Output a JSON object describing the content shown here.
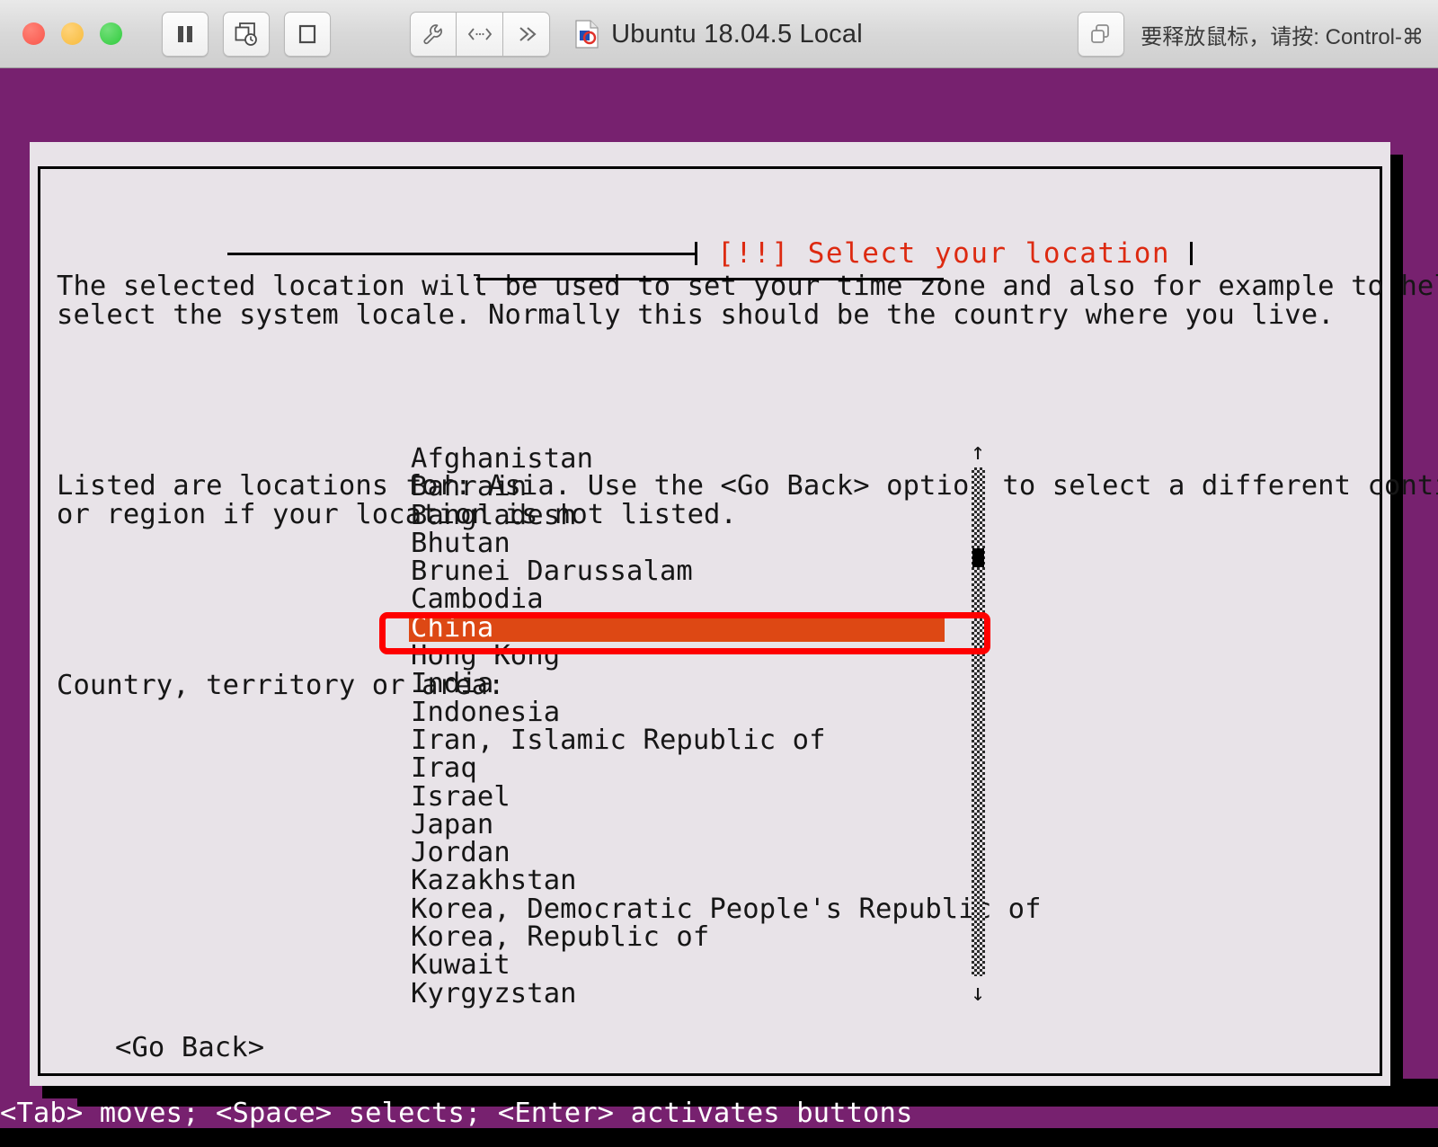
{
  "window": {
    "title": "Ubuntu 18.04.5 Local",
    "release_hint": "要释放鼠标，请按: Control-⌘",
    "traffic_lights": [
      "close",
      "minimize",
      "zoom"
    ],
    "toolbar": {
      "pause_label": "pause",
      "snapshot_label": "snapshot",
      "stop_label": "stop",
      "settings_label": "settings",
      "resize_label": "resize",
      "more_label": "more",
      "windows_label": "windows"
    }
  },
  "dialog": {
    "title": "[!!] Select your location",
    "paragraphs": [
      "The selected location will be used to set your time zone and also for example to help\nselect the system locale. Normally this should be the country where you live.",
      "Listed are locations for: Asia. Use the <Go Back> option to select a different continent\nor region if your location is not listed."
    ],
    "list_label": "Country, territory or area:",
    "go_back": "<Go Back>",
    "selected_item": "China",
    "items": [
      "Afghanistan",
      "Bahrain",
      "Bangladesh",
      "Bhutan",
      "Brunei Darussalam",
      "Cambodia",
      "China",
      "Hong Kong",
      "India",
      "Indonesia",
      "Iran, Islamic Republic of",
      "Iraq",
      "Israel",
      "Japan",
      "Jordan",
      "Kazakhstan",
      "Korea, Democratic People's Republic of",
      "Korea, Republic of",
      "Kuwait",
      "Kyrgyzstan"
    ],
    "scrollbar": {
      "up_arrow": "↑",
      "down_arrow": "↓",
      "thumb_position_percent": 16
    }
  },
  "status_bar": {
    "help": "<Tab> moves; <Space> selects; <Enter> activates buttons"
  },
  "colors": {
    "ubuntu_purple": "#77216f",
    "ubuntu_orange": "#dd4814",
    "title_red": "#dd2a11",
    "annotation_red": "#fe0000",
    "dialog_bg": "#e8e3e8",
    "text": "#161616"
  }
}
